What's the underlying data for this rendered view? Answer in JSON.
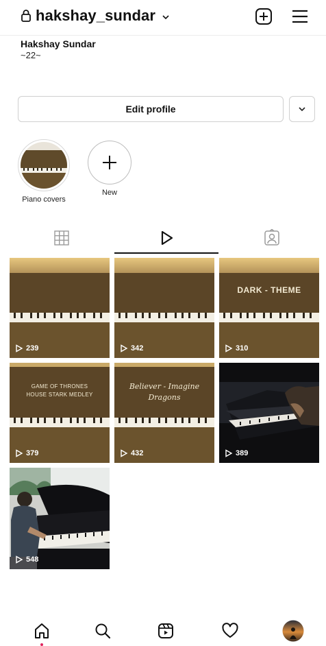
{
  "header": {
    "username": "hakshay_sundar",
    "icons": [
      "lock-icon",
      "chevron-down-icon",
      "new-post-icon",
      "menu-icon"
    ]
  },
  "bio": {
    "name": "Hakshay Sundar",
    "text": "~22~"
  },
  "actions": {
    "edit_profile_label": "Edit profile"
  },
  "highlights": [
    {
      "label": "Piano covers"
    },
    {
      "label": "New"
    }
  ],
  "tabs": [
    {
      "name": "grid",
      "icon": "grid-icon"
    },
    {
      "name": "reels",
      "icon": "reels-play-icon",
      "active": true
    },
    {
      "name": "tagged",
      "icon": "tagged-icon"
    }
  ],
  "reels": [
    {
      "views": "239"
    },
    {
      "views": "342"
    },
    {
      "views": "310",
      "overlay": "DARK - THEME"
    },
    {
      "views": "379",
      "overlay_line1": "GAME OF THRONES",
      "overlay_line2": "HOUSE STARK MEDLEY"
    },
    {
      "views": "432",
      "overlay_line1": "Believer - Imagine",
      "overlay_line2": "Dragons"
    },
    {
      "views": "389"
    },
    {
      "views": "548"
    }
  ],
  "bottom_nav": [
    "home-icon",
    "search-icon",
    "reels-icon",
    "heart-icon",
    "profile-avatar"
  ],
  "colors": {
    "accent": "#111111",
    "piano_brown": "#5a4426",
    "notification_dot": "#e0245e"
  }
}
